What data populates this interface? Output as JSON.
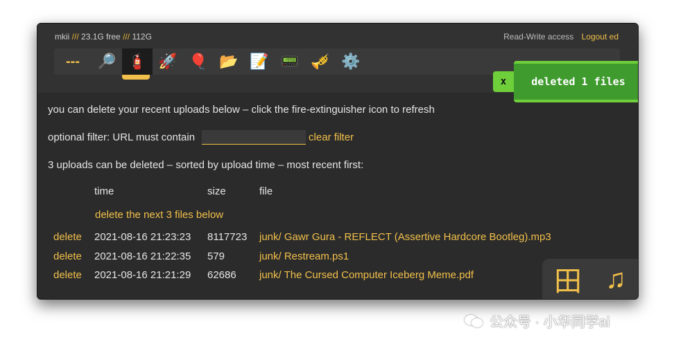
{
  "status": {
    "host": "mkii",
    "sep": "///",
    "free": "23.1G free",
    "total": "112G"
  },
  "access": {
    "mode": "Read-Write access",
    "logout": "Logout ed"
  },
  "iconbar": {
    "dash": "---",
    "icons": [
      "search-icon",
      "fire-extinguisher-icon",
      "rocket-icon",
      "balloon-icon",
      "folder-icon",
      "memo-icon",
      "pager-icon",
      "trumpet-icon",
      "gear-icon"
    ]
  },
  "toast": {
    "close": "x",
    "message": "deleted 1 files"
  },
  "content": {
    "intro": "you can delete your recent uploads below – click the fire-extinguisher icon to refresh",
    "filter_label": "optional filter:  URL must contain",
    "filter_value": "",
    "clear_filter": "clear filter",
    "summary": "3 uploads can be deleted – sorted by upload time – most recent first:"
  },
  "table": {
    "headers": {
      "time": "time",
      "size": "size",
      "file": "file"
    },
    "delete_next": "delete the next 3 files below",
    "rows": [
      {
        "action": "delete",
        "time": "2021-08-16 21:23:23",
        "size": "8117723",
        "file": "junk/ Gawr Gura - REFLECT (Assertive Hardcore Bootleg).mp3"
      },
      {
        "action": "delete",
        "time": "2021-08-16 21:22:35",
        "size": "579",
        "file": "junk/ Restream.ps1"
      },
      {
        "action": "delete",
        "time": "2021-08-16 21:21:29",
        "size": "62686",
        "file": "junk/ The Cursed Computer Iceberg Meme.pdf"
      }
    ]
  },
  "corner": {
    "grid": "田",
    "music": "♫"
  },
  "watermark": {
    "text": "公众号 · 小华同学ai"
  },
  "colors": {
    "accent": "#f2c04a",
    "toast_green": "#3f9b2e",
    "toast_light": "#6fcf3a",
    "bg": "#2b2b2b"
  }
}
